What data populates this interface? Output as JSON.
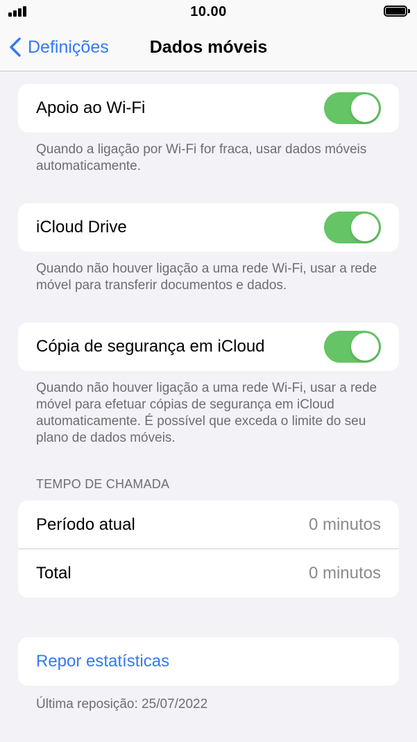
{
  "status_bar": {
    "time": "10.00"
  },
  "nav": {
    "back_label": "Definições",
    "title": "Dados móveis"
  },
  "settings": [
    {
      "label": "Apoio ao Wi-Fi",
      "enabled": true,
      "footer": "Quando a ligação por Wi-Fi for fraca, usar dados móveis automaticamente."
    },
    {
      "label": "iCloud Drive",
      "enabled": true,
      "footer": "Quando não houver ligação a uma rede Wi-Fi, usar a rede móvel para transferir documentos e dados."
    },
    {
      "label": "Cópia de segurança em iCloud",
      "enabled": true,
      "footer": "Quando não houver ligação a uma rede Wi-Fi, usar a rede móvel para efetuar cópias de segurança em iCloud automaticamente. É possível que exceda o limite do seu plano de dados móveis."
    }
  ],
  "call_time": {
    "header": "TEMPO DE CHAMADA",
    "rows": [
      {
        "label": "Período atual",
        "value": "0 minutos"
      },
      {
        "label": "Total",
        "value": "0 minutos"
      }
    ]
  },
  "reset": {
    "label": "Repor estatísticas",
    "footer": "Última reposição: 25/07/2022"
  },
  "colors": {
    "accent": "#3478f6",
    "toggle_on": "#65c466",
    "background": "#f2f2f7"
  }
}
